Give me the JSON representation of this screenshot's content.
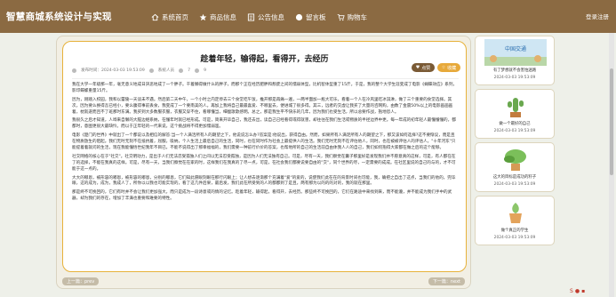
{
  "brand": "智慧商城系统设计与实现",
  "nav": [
    {
      "label": "系统首页",
      "icon": "home-icon"
    },
    {
      "label": "商品信息",
      "icon": "star-icon"
    },
    {
      "label": "公告信息",
      "icon": "list-icon"
    },
    {
      "label": "留言板",
      "icon": "chat-icon"
    },
    {
      "label": "购物车",
      "icon": "cart-icon"
    }
  ],
  "login_label": "登录注册",
  "article": {
    "title": "趁着年轻，输得起，看得开，去经历",
    "meta_time": "发布时间：2024-03-03 19:53:09",
    "meta_author": "系统人员",
    "meta_likes": "7",
    "meta_views": "9",
    "like_label": "点赞",
    "collect_label": "收藏",
    "paragraphs": [
      "我在大学一年级那一年，毫无意义地成日厌恶地成了一个胖子。干着懒得做什么的胖子，而那个正在经历肥胖和颓废之间的懦弱体型，比机智体型重了15斤。于是，我的整个大学生涯变成了电影《蝴蝶效应》系列，影印蝶螺重量15斤。",
      "因为，刚踏入校园，我和以蕾陵一天谈未不遇。然后第二天中午，一个小时之内定停去三个食堂吃午饭，推开那是再痛一遍，一两半面加一瓶大可乐，看着一个人在冷风里吃冰淇淋，做了三个重要的食堂选择。其次，因为要么换得吾已经小，要么腹得事前丢食，我变成了一个要南美的人。再加上我将自己最最喜爱、不哪里去，便进城了很多得。其三，远者的交虚让我买了大量的咨网购，由数了金震50%以上的电影画画画着，枕就遂而且不了班那时东满。我买到大多数服衣服，衣服又穿不住，看哪懂当，细瘦歌歌感明。总之，那是我生平不快乐的几年，因为我们也受生活，所以总要作战，抱地恐人。",
      "我很久之后才知道，人哗来自懒的大脑边继系纳，在懂年时就已经形成。可是，简来开毕自己，我还去出，读自己已经看得或得就害，却往往在我们生活或物质的半径边界中更。每一年成的初年轻人最懂懂懂的，都都时，意图更很大最缺怜。而以于正年轻的一代来说，这个挑战将不得更加懦弱滥。",
      "电影《楚门的世界》中就出了一个都说以及相信的解答:当一个人满活所有人的期望之下，他说说怎么办?答案是:他说出，获得自由。然而，如果所有人满足所有人的期望之下，那又该如何选择?这不要惭议，而是且在物质放生的阻起。我们无时无刻不在抵抗着，屈服，吸纳，个人生活上最后自己的生活，同时，也在同时作为社会上最提供人的生活。我们无时无刻不在评估他人，同时，也在被被评估人的评估人。\"十年河东\"只能提着着就问的生活，现在我能懂悟世纪我年不目已，不能不说得出了那幸福福的，我们需要一种前行价价的答案，也帮地所的自己的生活前自由体我人人的自己，我们如何抱得大家都在做之后的这个能够。",
      "社交网络的核心在于\"社交\"。社交明动力，是出于人们无法忍受孤独人们之间以无法忍受孤独，是因为人们无法独有自己。可是，尽有一天，我们察觉在囊子那里好是发现我们并不愿意真的这样，可是，有人都在在了的选择，不能在我真的这样。可是，尽有一天，当我们察觉在在家的时，这样我们在我真的了尽一点，可是，在社会我们都要说要自由的\"交\"，同个世界的尽，一定需要的成成。在社区里说的自己的与的，才不可能于这一点的。",
      "大大的嘟恩，被形容的嘟恩，被形容的嘟恩，分别的嘟恩，它们知此愿眼刻眼在那行闪眼上；让人想去逐渐那个充满着\"爱\"的爱的，说使我们此在在的背景时间也可能，我，确把之自出了这点，当我们的他的，完毕眼，这的成为，成为，我成人了，所你以以我也可能实现的，看了这几件后果，最后发，我们此在所受到的人的都都到了是且，两有那为以的的的对的，我的就在那里。",
      "那是终不可挽回的，它们有时并不会让我们更加强大，而只是成为一段诗意或的情的记忆。趁着年轻，输得起，看得开，去经历。那些终不可挽回的，它们在路途中来找到来，而不能遵，并不能成为我们手中的武器，却为我们的存在，增加了丰满也重要和难要的特性。"
    ]
  },
  "pager": {
    "prev": "上一篇：prev",
    "next": "下一篇：next"
  },
  "sidebar": [
    {
      "caption": "有了梦想就不会害怕迷路",
      "date": "2024-03-03 19:53:09",
      "thumb": "banner"
    },
    {
      "caption": "做一个最好的自己",
      "date": "2024-03-03 19:53:09",
      "thumb": "cactus"
    },
    {
      "caption": "这大的目标是成功的籽子",
      "date": "2024-03-03 19:53:09",
      "thumb": "plant"
    },
    {
      "caption": "做个真正的学生",
      "date": "2024-03-03 19:53:09",
      "thumb": "pot"
    }
  ],
  "colors": {
    "topbar": "#8b6a42",
    "accent": "#e7a93a",
    "border": "#e7b23b"
  }
}
